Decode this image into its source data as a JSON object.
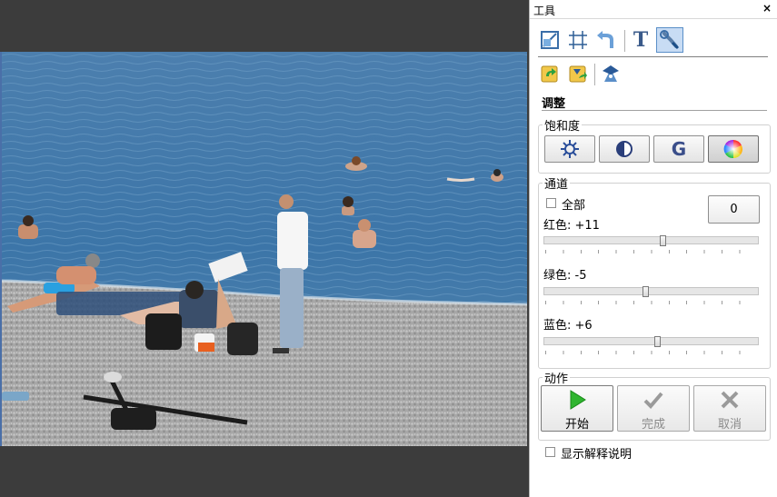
{
  "panel": {
    "title": "工具",
    "close_glyph": "×"
  },
  "toolbar": {
    "row1": [
      {
        "name": "resize-icon"
      },
      {
        "name": "crop-icon"
      },
      {
        "name": "undo-icon"
      },
      {
        "name": "text-icon",
        "glyph": "T"
      },
      {
        "name": "wrench-icon",
        "selected": true
      }
    ],
    "row2": [
      {
        "name": "rotate-left-icon"
      },
      {
        "name": "rotate-right-icon"
      },
      {
        "name": "wizard-icon"
      }
    ]
  },
  "adjust": {
    "heading": "调整"
  },
  "saturation": {
    "label": "饱和度",
    "buttons": [
      {
        "name": "brightness-icon"
      },
      {
        "name": "contrast-icon"
      },
      {
        "name": "grayscale-icon",
        "glyph": "G"
      },
      {
        "name": "color-wheel-icon",
        "active": true
      }
    ]
  },
  "channels": {
    "label": "通道",
    "all_label": "全部",
    "all_checked": false,
    "value": "0",
    "red": {
      "label": "红色: +11",
      "value": 11
    },
    "green": {
      "label": "绿色: -5",
      "value": -5
    },
    "blue": {
      "label": "蓝色: +6",
      "value": 6
    }
  },
  "actions": {
    "label": "动作",
    "start": "开始",
    "done": "完成",
    "cancel": "取消"
  },
  "footer": {
    "show_help_label": "显示解释说明",
    "show_help_checked": false
  },
  "colors": {
    "selected_tool": "#c8dcf4",
    "start_green": "#2fb52f",
    "sea": "#3b77a8",
    "sand": "#a8a8a8"
  }
}
